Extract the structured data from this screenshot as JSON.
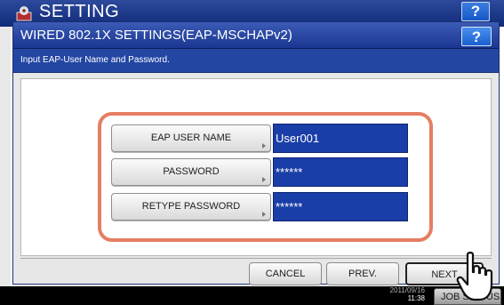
{
  "background": {
    "title": "SETTING",
    "help_label": "?",
    "clock_date": "2011/09/16",
    "clock_time": "11:38",
    "job_status_label": "JOB STATUS"
  },
  "dialog": {
    "title": "WIRED 802.1X SETTINGS(EAP-MSCHAPv2)",
    "help_label": "?",
    "message": "Input EAP-User Name and Password."
  },
  "fields": [
    {
      "label": "EAP USER NAME",
      "value": "User001"
    },
    {
      "label": "PASSWORD",
      "value": "******"
    },
    {
      "label": "RETYPE PASSWORD",
      "value": "******"
    }
  ],
  "footer": {
    "cancel_label": "CANCEL",
    "prev_label": "PREV.",
    "next_label": "NEXT"
  },
  "colors": {
    "title_bar": "#1a3690",
    "message_bar": "#2346a3",
    "value_field": "#1a3ea8",
    "highlight_ring": "#e57e62"
  },
  "icons": {
    "setting": "setting-gear-icon",
    "pointer": "hand-pointer-icon",
    "field_arrow": "arrow-right-icon"
  }
}
